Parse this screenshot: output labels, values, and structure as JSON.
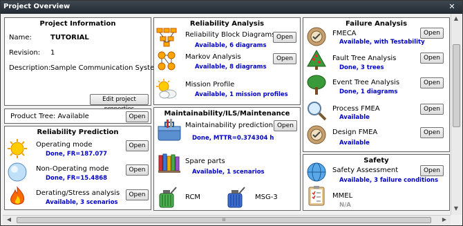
{
  "window": {
    "title": "Project Overview",
    "close": "✕"
  },
  "project_info": {
    "title": "Project Information",
    "name_label": "Name:",
    "name_value": "TUTORIAL",
    "revision_label": "Revision:",
    "revision_value": "1",
    "description_label": "Description:",
    "description_value": "Sample Communication System",
    "edit_button": "Edit project properties"
  },
  "product_tree": {
    "label": "Product Tree: Available",
    "open": "Open"
  },
  "reliability_prediction": {
    "title": "Reliability Prediction",
    "items": [
      {
        "label": "Operating mode",
        "status": "Done, FR=187.077",
        "open": "Open"
      },
      {
        "label": "Non-Operating mode",
        "status": "Done, FR=15.4868",
        "open": "Open"
      },
      {
        "label": "Derating/Stress analysis",
        "status": "Available, 3 scenarios",
        "open": "Open"
      }
    ]
  },
  "reliability_analysis": {
    "title": "Reliability Analysis",
    "items": [
      {
        "label": "Reliability Block Diagrams",
        "status": "Available, 6 diagrams",
        "open": "Open"
      },
      {
        "label": "Markov Analysis",
        "status": "Available, 8 diagrams",
        "open": "Open"
      },
      {
        "label": "Mission Profile",
        "status": "Available, 1 mission profiles"
      }
    ]
  },
  "maintainability": {
    "title": "Maintainability/ILS/Maintenance",
    "items": [
      {
        "label": "Maintainability prediction",
        "status": "Done, MTTR=0.374304 h",
        "open": "Open"
      },
      {
        "label": "Spare parts",
        "status": "Available, 1 scenarios"
      },
      {
        "label": "RCM"
      },
      {
        "label": "MSG-3"
      }
    ]
  },
  "failure_analysis": {
    "title": "Failure Analysis",
    "items": [
      {
        "label": "FMECA",
        "status": "Available, with Testability",
        "open": "Open"
      },
      {
        "label": "Fault Tree Analysis",
        "status": "Done, 3 trees",
        "open": "Open"
      },
      {
        "label": "Event Tree Analysis",
        "status": "Done, 1 diagrams",
        "open": "Open"
      },
      {
        "label": "Process FMEA",
        "status": "Available",
        "open": "Open"
      },
      {
        "label": "Design FMEA",
        "status": "Available",
        "open": "Open"
      }
    ]
  },
  "safety": {
    "title": "Safety",
    "items": [
      {
        "label": "Safety Assessment",
        "status": "Available, 3 failure conditions",
        "open": "Open"
      },
      {
        "label": "MMEL",
        "status": "N/A"
      }
    ]
  },
  "scrollbars": {
    "up": "▲",
    "down": "▼",
    "left": "◀",
    "right": "▶",
    "grip": "III"
  }
}
